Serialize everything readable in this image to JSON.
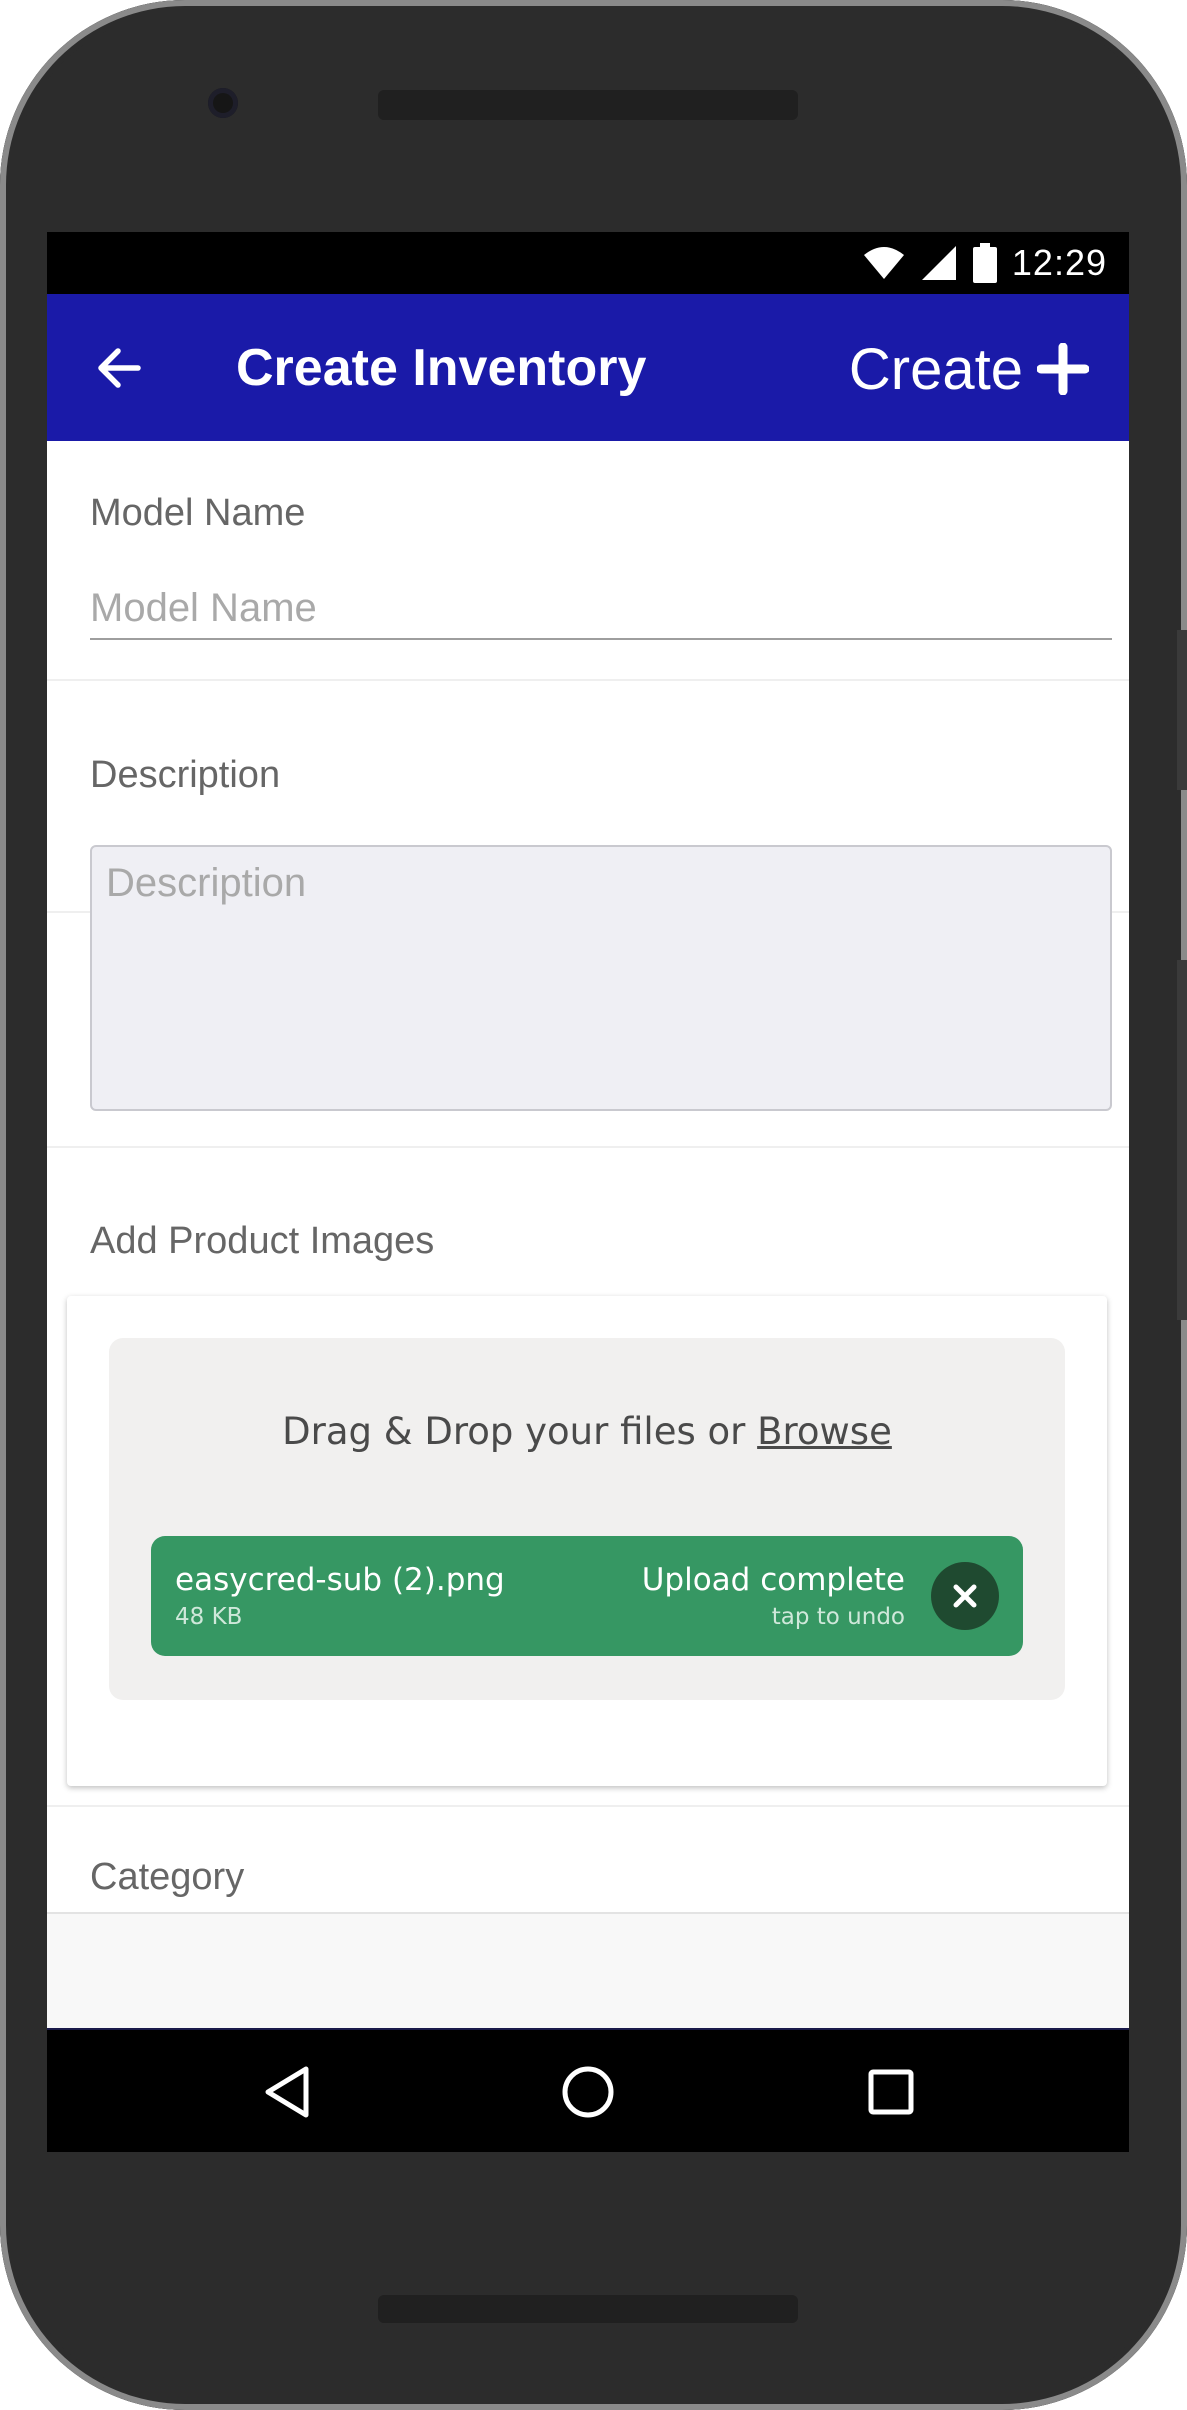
{
  "status_bar": {
    "time": "12:29",
    "icons": [
      "wifi-icon",
      "cellular-signal-icon",
      "battery-icon"
    ]
  },
  "app_bar": {
    "title": "Create Inventory",
    "back_icon": "arrow-left-icon",
    "create_label": "Create",
    "create_icon": "plus-icon",
    "color": "#1a1aa8"
  },
  "form": {
    "model_name": {
      "label": "Model Name",
      "placeholder": "Model Name",
      "value": ""
    },
    "description": {
      "label": "Description",
      "placeholder": "Description",
      "value": ""
    },
    "product_images": {
      "label": "Add Product Images",
      "drop_text": "Drag & Drop your files or",
      "browse_label": "Browse",
      "files": [
        {
          "name": "easycred-sub (2).png",
          "size": "48 KB",
          "status": "Upload complete",
          "undo_hint": "tap to undo"
        }
      ],
      "success_color": "#369763"
    },
    "category": {
      "label": "Category"
    }
  },
  "nav_bar": {
    "buttons": [
      "back-triangle-icon",
      "home-circle-icon",
      "recents-square-icon"
    ]
  }
}
